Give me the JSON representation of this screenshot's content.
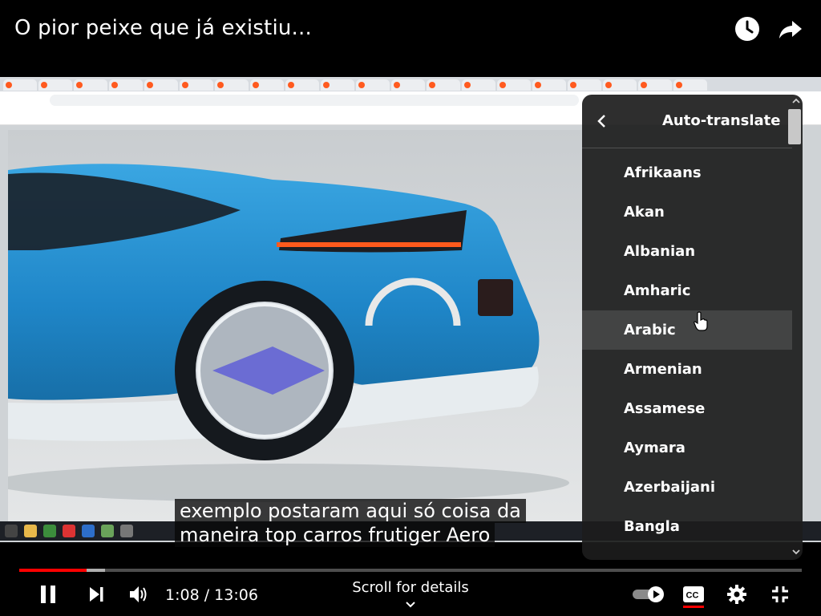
{
  "title": "O pior peixe que já existiu...",
  "header_icons": [
    "watch-later-icon",
    "share-icon"
  ],
  "subtitle_lines": [
    "exemplo postaram aqui só coisa da",
    "maneira top carros frutiger Aero"
  ],
  "settings_menu": {
    "title": "Auto-translate",
    "items": [
      "Afrikaans",
      "Akan",
      "Albanian",
      "Amharic",
      "Arabic",
      "Armenian",
      "Assamese",
      "Aymara",
      "Azerbaijani",
      "Bangla"
    ],
    "hovered_item": "Arabic"
  },
  "player": {
    "current_time": "1:08",
    "separator": " / ",
    "duration": "13:06",
    "scroll_hint": "Scroll for details",
    "played_fraction": 0.0865,
    "buffered_fraction": 0.11,
    "autoplay_on": true,
    "captions_on": true
  },
  "colors": {
    "accent_red": "#ff0000",
    "car_blue": "#2a8fd0",
    "menu_bg": "#1c1c1c"
  }
}
